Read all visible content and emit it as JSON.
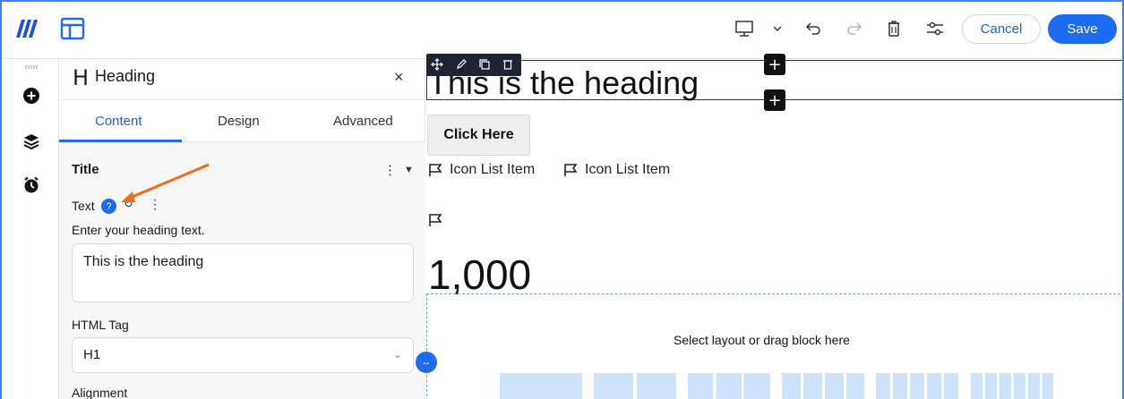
{
  "topbar": {
    "logo_icon": "brand-logo-icon",
    "cancel_label": "Cancel",
    "save_label": "Save",
    "accent": "#1d6bf0"
  },
  "panel": {
    "title": "Heading",
    "close": "×",
    "tabs": [
      {
        "label": "Content",
        "active": true
      },
      {
        "label": "Design",
        "active": false
      },
      {
        "label": "Advanced",
        "active": false
      }
    ],
    "section_title": "Title",
    "text_label": "Text",
    "text_hint": "Enter your heading text.",
    "text_value": "This is the heading",
    "html_tag_label": "HTML Tag",
    "html_tag_value": "H1",
    "alignment_label": "Alignment"
  },
  "canvas": {
    "heading": "This is the heading",
    "button_label": "Click Here",
    "icon_list_items": [
      "Icon List Item",
      "Icon List Item"
    ],
    "counter": "1,000",
    "drop_hint": "Select layout or drag block here"
  }
}
